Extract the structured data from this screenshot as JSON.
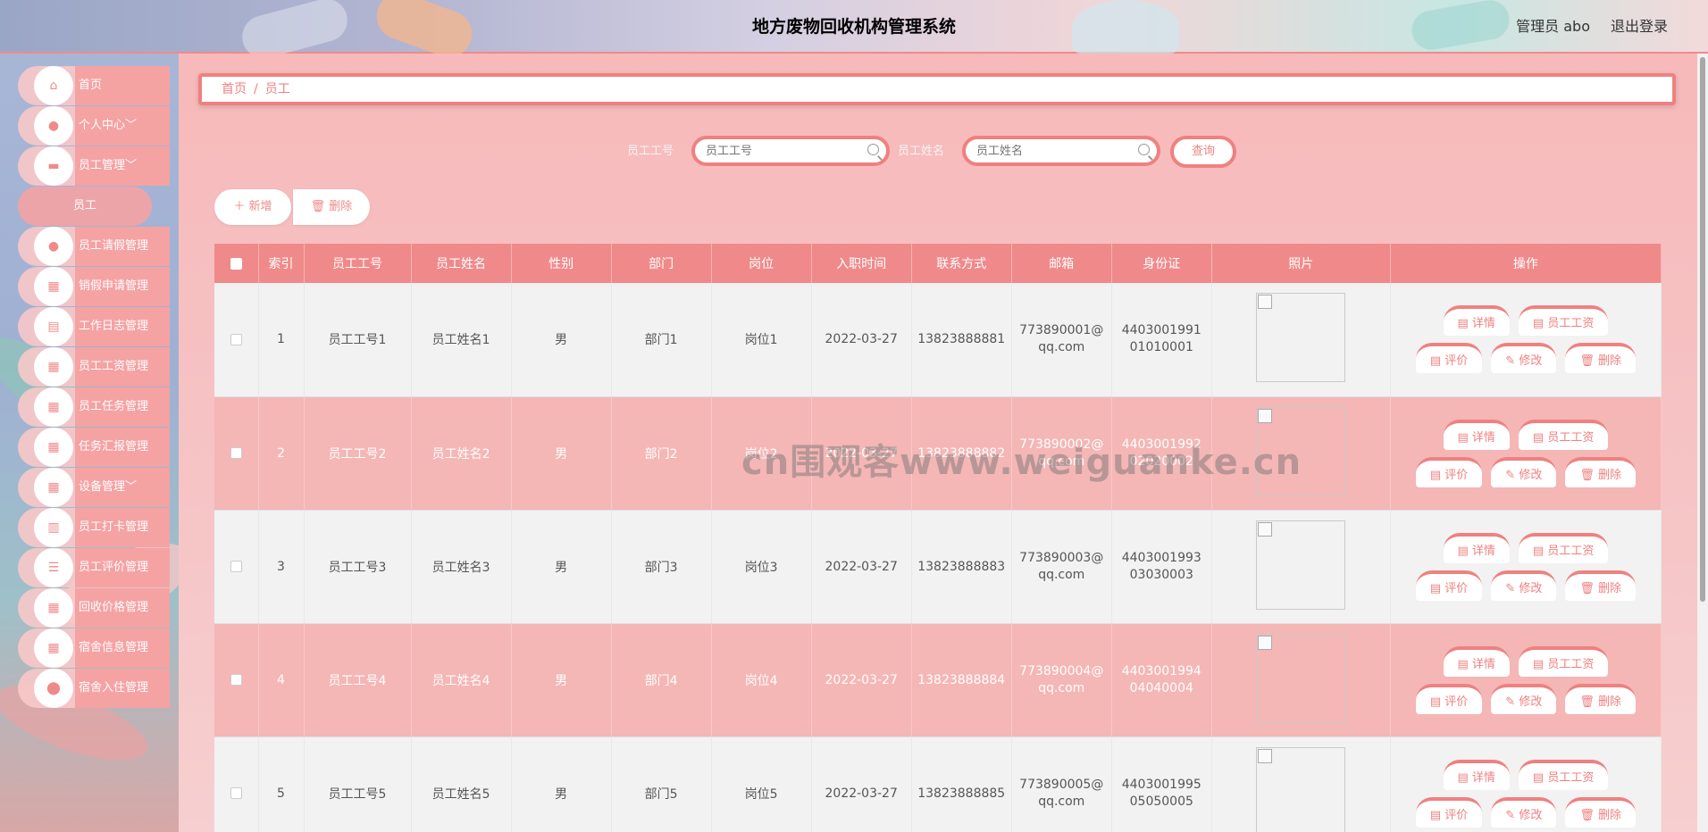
{
  "header": {
    "title": "地方废物回收机构管理系统",
    "user": "管理员 abo",
    "logout": "退出登录"
  },
  "sidebar": {
    "items": [
      {
        "label": "首页",
        "icon": "home-icon"
      },
      {
        "label": "个人中心﹀",
        "icon": "user-icon"
      },
      {
        "label": "员工管理﹀",
        "icon": "briefcase-icon"
      },
      {
        "label": "员工",
        "icon": ""
      },
      {
        "label": "员工请假管理",
        "icon": "user-icon"
      },
      {
        "label": "销假申请管理",
        "icon": "grid-icon"
      },
      {
        "label": "工作日志管理",
        "icon": "clipboard-icon"
      },
      {
        "label": "员工工资管理",
        "icon": "grid-icon"
      },
      {
        "label": "员工任务管理",
        "icon": "grid-icon"
      },
      {
        "label": "任务汇报管理",
        "icon": "grid-icon"
      },
      {
        "label": "设备管理﹀",
        "icon": "grid-icon"
      },
      {
        "label": "员工打卡管理",
        "icon": "chart-icon"
      },
      {
        "label": "员工评价管理",
        "icon": "list-icon"
      },
      {
        "label": "回收价格管理",
        "icon": "grid-icon"
      },
      {
        "label": "宿舍信息管理",
        "icon": "grid-icon"
      },
      {
        "label": "宿舍入住管理",
        "icon": "pin-icon"
      }
    ]
  },
  "breadcrumb": {
    "home": "首页",
    "sep": "/",
    "current": "员工"
  },
  "search": {
    "no_label": "员工工号",
    "no_placeholder": "员工工号",
    "name_label": "员工姓名",
    "name_placeholder": "员工姓名",
    "query": "查询"
  },
  "actions": {
    "add": "＋ 新增",
    "delete": "🗑 删除"
  },
  "table": {
    "headers": [
      "",
      "索引",
      "员工工号",
      "员工姓名",
      "性别",
      "部门",
      "岗位",
      "入职时间",
      "联系方式",
      "邮箱",
      "身份证",
      "照片",
      "操作"
    ],
    "rows": [
      {
        "idx": "1",
        "no": "员工工号1",
        "name": "员工姓名1",
        "gender": "男",
        "dept": "部门1",
        "post": "岗位1",
        "date": "2022-03-27",
        "phone": "13823888881",
        "email": "773890001@qq.com",
        "id": "440300199101010001"
      },
      {
        "idx": "2",
        "no": "员工工号2",
        "name": "员工姓名2",
        "gender": "男",
        "dept": "部门2",
        "post": "岗位2",
        "date": "2022-03-27",
        "phone": "13823888882",
        "email": "773890002@qq.com",
        "id": "440300199202020002"
      },
      {
        "idx": "3",
        "no": "员工工号3",
        "name": "员工姓名3",
        "gender": "男",
        "dept": "部门3",
        "post": "岗位3",
        "date": "2022-03-27",
        "phone": "13823888883",
        "email": "773890003@qq.com",
        "id": "440300199303030003"
      },
      {
        "idx": "4",
        "no": "员工工号4",
        "name": "员工姓名4",
        "gender": "男",
        "dept": "部门4",
        "post": "岗位4",
        "date": "2022-03-27",
        "phone": "13823888884",
        "email": "773890004@qq.com",
        "id": "440300199404040004"
      },
      {
        "idx": "5",
        "no": "员工工号5",
        "name": "员工姓名5",
        "gender": "男",
        "dept": "部门5",
        "post": "岗位5",
        "date": "2022-03-27",
        "phone": "13823888885",
        "email": "773890005@qq.com",
        "id": "440300199505050005"
      }
    ],
    "ops": {
      "detail": "▤ 详情",
      "salary": "▤ 员工工资",
      "review": "▤ 评价",
      "edit": "✎ 修改",
      "remove": "🗑 删除"
    }
  },
  "watermark": "cn围观客www.weiguanke.cn",
  "colors": {
    "accent": "#f08a8a",
    "row_alt": "#f5b6b6",
    "row": "#f2f2f2"
  }
}
